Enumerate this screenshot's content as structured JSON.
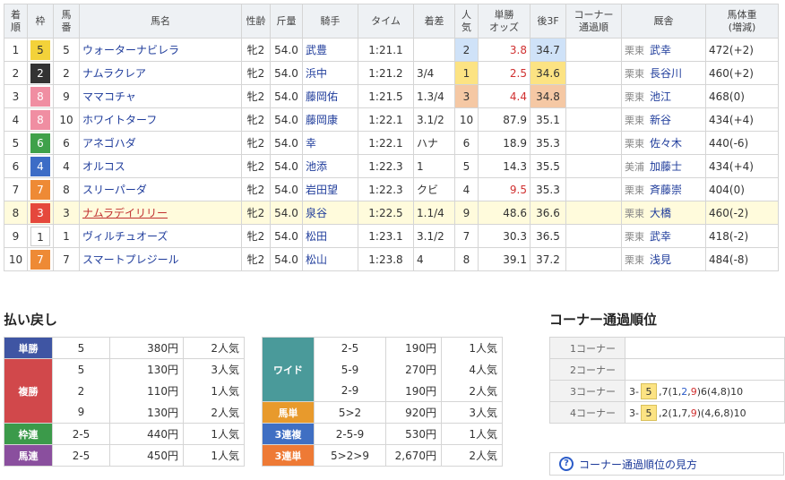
{
  "headers": {
    "rank": "着\n順",
    "frame": "枠",
    "num": "馬\n番",
    "name": "馬名",
    "sexage": "性齢",
    "weight": "斤量",
    "jockey": "騎手",
    "time": "タイム",
    "margin": "着差",
    "pop": "人\n気",
    "odds": "単勝\nオッズ",
    "last3f": "後3F",
    "corner": "コーナー\n通過順",
    "trainer": "厩舎",
    "bodyweight": "馬体重\n(増減)"
  },
  "rows": [
    {
      "rank": "1",
      "frame": "5",
      "num": "5",
      "name": "ウォーターナビレラ",
      "sexage": "牝2",
      "weight": "54.0",
      "jockey": "武豊",
      "time": "1:21.1",
      "margin": "",
      "pop": "2",
      "odds": "3.8",
      "last3f": "34.7",
      "corner": "",
      "area": "栗東",
      "trainer": "武幸",
      "bw": "472(+2)"
    },
    {
      "rank": "2",
      "frame": "2",
      "num": "2",
      "name": "ナムラクレア",
      "sexage": "牝2",
      "weight": "54.0",
      "jockey": "浜中",
      "time": "1:21.2",
      "margin": "3/4",
      "pop": "1",
      "odds": "2.5",
      "last3f": "34.6",
      "corner": "",
      "area": "栗東",
      "trainer": "長谷川",
      "bw": "460(+2)"
    },
    {
      "rank": "3",
      "frame": "8",
      "num": "9",
      "name": "ママコチャ",
      "sexage": "牝2",
      "weight": "54.0",
      "jockey": "藤岡佑",
      "time": "1:21.5",
      "margin": "1.3/4",
      "pop": "3",
      "odds": "4.4",
      "last3f": "34.8",
      "corner": "",
      "area": "栗東",
      "trainer": "池江",
      "bw": "468(0)"
    },
    {
      "rank": "4",
      "frame": "8",
      "num": "10",
      "name": "ホワイトターフ",
      "sexage": "牝2",
      "weight": "54.0",
      "jockey": "藤岡康",
      "time": "1:22.1",
      "margin": "3.1/2",
      "pop": "10",
      "odds": "87.9",
      "last3f": "35.1",
      "corner": "",
      "area": "栗東",
      "trainer": "新谷",
      "bw": "434(+4)"
    },
    {
      "rank": "5",
      "frame": "6",
      "num": "6",
      "name": "アネゴハダ",
      "sexage": "牝2",
      "weight": "54.0",
      "jockey": "幸",
      "time": "1:22.1",
      "margin": "ハナ",
      "pop": "6",
      "odds": "18.9",
      "last3f": "35.3",
      "corner": "",
      "area": "栗東",
      "trainer": "佐々木",
      "bw": "440(-6)"
    },
    {
      "rank": "6",
      "frame": "4",
      "num": "4",
      "name": "オルコス",
      "sexage": "牝2",
      "weight": "54.0",
      "jockey": "池添",
      "time": "1:22.3",
      "margin": "1",
      "pop": "5",
      "odds": "14.3",
      "last3f": "35.5",
      "corner": "",
      "area": "美浦",
      "trainer": "加藤士",
      "bw": "434(+4)"
    },
    {
      "rank": "7",
      "frame": "7",
      "num": "8",
      "name": "スリーパーダ",
      "sexage": "牝2",
      "weight": "54.0",
      "jockey": "岩田望",
      "time": "1:22.3",
      "margin": "クビ",
      "pop": "4",
      "odds": "9.5",
      "last3f": "35.3",
      "corner": "",
      "area": "栗東",
      "trainer": "斉藤崇",
      "bw": "404(0)"
    },
    {
      "rank": "8",
      "frame": "3",
      "num": "3",
      "name": "ナムラデイリリー",
      "sexage": "牝2",
      "weight": "54.0",
      "jockey": "泉谷",
      "time": "1:22.5",
      "margin": "1.1/4",
      "pop": "9",
      "odds": "48.6",
      "last3f": "36.6",
      "corner": "",
      "area": "栗東",
      "trainer": "大橋",
      "bw": "460(-2)"
    },
    {
      "rank": "9",
      "frame": "1",
      "num": "1",
      "name": "ヴィルチュオーズ",
      "sexage": "牝2",
      "weight": "54.0",
      "jockey": "松田",
      "time": "1:23.1",
      "margin": "3.1/2",
      "pop": "7",
      "odds": "30.3",
      "last3f": "36.5",
      "corner": "",
      "area": "栗東",
      "trainer": "武幸",
      "bw": "418(-2)"
    },
    {
      "rank": "10",
      "frame": "7",
      "num": "7",
      "name": "スマートプレジール",
      "sexage": "牝2",
      "weight": "54.0",
      "jockey": "松山",
      "time": "1:23.8",
      "margin": "4",
      "pop": "8",
      "odds": "39.1",
      "last3f": "37.2",
      "corner": "",
      "area": "栗東",
      "trainer": "浅見",
      "bw": "484(-8)"
    }
  ],
  "frame_colors": {
    "1": {
      "bg": "#ffffff",
      "fg": "#333333",
      "border": "#cccccc"
    },
    "2": {
      "bg": "#333333",
      "fg": "#ffffff"
    },
    "3": {
      "bg": "#e5483c",
      "fg": "#ffffff"
    },
    "4": {
      "bg": "#3c6cc6",
      "fg": "#ffffff"
    },
    "5": {
      "bg": "#f3d23a",
      "fg": "#333333"
    },
    "6": {
      "bg": "#3fa14a",
      "fg": "#ffffff"
    },
    "7": {
      "bg": "#ee8a35",
      "fg": "#ffffff"
    },
    "8": {
      "bg": "#f08ea2",
      "fg": "#ffffff"
    }
  },
  "payout": {
    "title": "払い戻し",
    "tanshou": {
      "label": "単勝",
      "color": "#3f55a3",
      "entries": [
        {
          "combo": "5",
          "amount": "380円",
          "pop": "2人気"
        }
      ]
    },
    "fukushou": {
      "label": "複勝",
      "color": "#d1484b",
      "entries": [
        {
          "combo": "5",
          "amount": "130円",
          "pop": "3人気"
        },
        {
          "combo": "2",
          "amount": "110円",
          "pop": "1人気"
        },
        {
          "combo": "9",
          "amount": "130円",
          "pop": "2人気"
        }
      ]
    },
    "wakuren": {
      "label": "枠連",
      "color": "#3b9a4a",
      "entries": [
        {
          "combo": "2-5",
          "amount": "440円",
          "pop": "1人気"
        }
      ]
    },
    "umaren": {
      "label": "馬連",
      "color": "#8a4f9e",
      "entries": [
        {
          "combo": "2-5",
          "amount": "450円",
          "pop": "1人気"
        }
      ]
    },
    "wide": {
      "label": "ワイド",
      "color": "#4a9a9a",
      "entries": [
        {
          "combo": "2-5",
          "amount": "190円",
          "pop": "1人気"
        },
        {
          "combo": "5-9",
          "amount": "270円",
          "pop": "4人気"
        },
        {
          "combo": "2-9",
          "amount": "190円",
          "pop": "2人気"
        }
      ]
    },
    "umatan": {
      "label": "馬単",
      "color": "#e89a2c",
      "entries": [
        {
          "combo": "5>2",
          "amount": "920円",
          "pop": "3人気"
        }
      ]
    },
    "sanrenpuku": {
      "label": "3連複",
      "color": "#3f6fc3",
      "entries": [
        {
          "combo": "2-5-9",
          "amount": "530円",
          "pop": "1人気"
        }
      ]
    },
    "sanrentan": {
      "label": "3連単",
      "color": "#ee7a35",
      "entries": [
        {
          "combo": "5>2>9",
          "amount": "2,670円",
          "pop": "2人気"
        }
      ]
    }
  },
  "corner": {
    "title": "コーナー通過順位",
    "rows": [
      {
        "label": "1コーナー",
        "lead": "",
        "parts": []
      },
      {
        "label": "2コーナー",
        "lead": "",
        "parts": []
      },
      {
        "label": "3コーナー",
        "prefix": "3-",
        "lead": "5",
        "parts": [
          {
            "t": ",7(1,",
            "c": ""
          },
          {
            "t": "2",
            "c": "blu"
          },
          {
            "t": ",",
            "c": ""
          },
          {
            "t": "9",
            "c": "red"
          },
          {
            "t": ")6(4,8)10",
            "c": ""
          }
        ]
      },
      {
        "label": "4コーナー",
        "prefix": "3-",
        "lead": "5",
        "parts": [
          {
            "t": ",2(1,7,",
            "c": ""
          },
          {
            "t": "9",
            "c": "red"
          },
          {
            "t": ")(4,6,8)10",
            "c": ""
          }
        ]
      }
    ],
    "help": "コーナー通過順位の見方"
  }
}
